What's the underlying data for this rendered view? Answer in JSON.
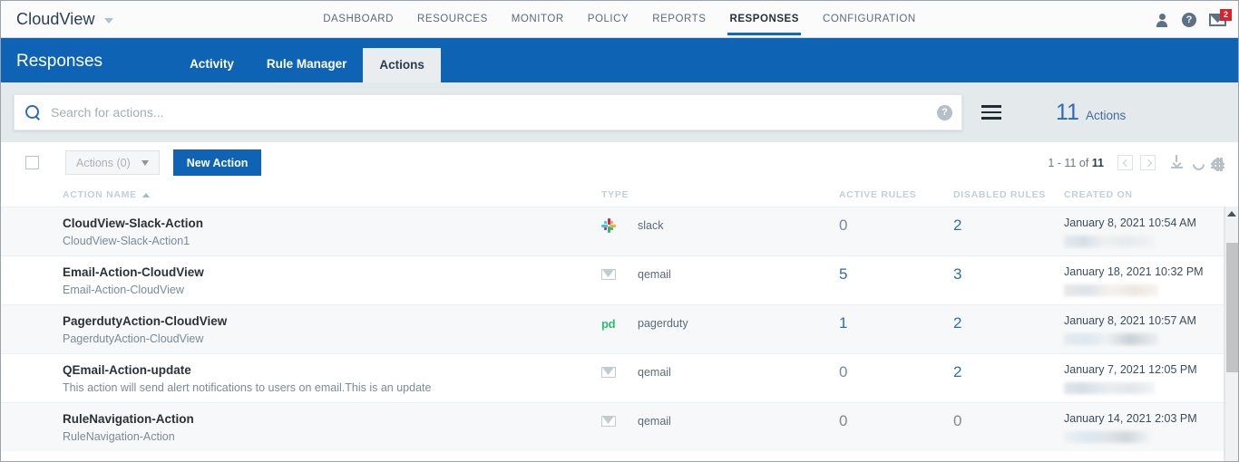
{
  "topbar": {
    "brand": "CloudView",
    "nav": [
      {
        "label": "DASHBOARD",
        "active": false
      },
      {
        "label": "RESOURCES",
        "active": false
      },
      {
        "label": "MONITOR",
        "active": false
      },
      {
        "label": "POLICY",
        "active": false
      },
      {
        "label": "REPORTS",
        "active": false
      },
      {
        "label": "RESPONSES",
        "active": true
      },
      {
        "label": "CONFIGURATION",
        "active": false
      }
    ],
    "help_glyph": "?",
    "mail_badge": "2"
  },
  "subheader": {
    "title": "Responses",
    "tabs": [
      {
        "label": "Activity",
        "active": false
      },
      {
        "label": "Rule Manager",
        "active": false
      },
      {
        "label": "Actions",
        "active": true
      }
    ]
  },
  "search": {
    "placeholder": "Search for actions...",
    "value": "",
    "help_glyph": "?",
    "count": "11",
    "count_label": "Actions"
  },
  "toolbar": {
    "actions_dropdown": "Actions (0)",
    "new_action": "New Action",
    "pager_text_prefix": "1 - 11 of ",
    "pager_total": "11"
  },
  "table": {
    "columns": [
      {
        "key": "name",
        "label": "ACTION NAME",
        "sorted": true
      },
      {
        "key": "type",
        "label": "TYPE"
      },
      {
        "key": "active",
        "label": "ACTIVE RULES"
      },
      {
        "key": "disabled",
        "label": "DISABLED RULES"
      },
      {
        "key": "created",
        "label": "CREATED ON"
      }
    ],
    "rows": [
      {
        "name": "CloudView-Slack-Action",
        "desc": "CloudView-Slack-Action1",
        "type_icon": "slack-icon",
        "type": "slack",
        "active_rules": "0",
        "active_is_link": false,
        "disabled_rules": "2",
        "disabled_is_link": true,
        "created": "January 8, 2021 10:54 AM"
      },
      {
        "name": "Email-Action-CloudView",
        "desc": "Email-Action-CloudView",
        "type_icon": "envelope-icon",
        "type": "qemail",
        "active_rules": "5",
        "active_is_link": true,
        "disabled_rules": "3",
        "disabled_is_link": true,
        "created": "January 18, 2021 10:32 PM"
      },
      {
        "name": "PagerdutyAction-CloudView",
        "desc": "PagerdutyAction-CloudView",
        "type_icon": "pagerduty-icon",
        "type": "pagerduty",
        "active_rules": "1",
        "active_is_link": true,
        "disabled_rules": "2",
        "disabled_is_link": true,
        "created": "January 8, 2021 10:57 AM"
      },
      {
        "name": "QEmail-Action-update",
        "desc": "This action will send alert notifications to users on email.This is an update",
        "type_icon": "envelope-icon",
        "type": "qemail",
        "active_rules": "0",
        "active_is_link": false,
        "disabled_rules": "2",
        "disabled_is_link": true,
        "created": "January 7, 2021 12:05 PM"
      },
      {
        "name": "RuleNavigation-Action",
        "desc": "RuleNavigation-Action",
        "type_icon": "envelope-icon",
        "type": "qemail",
        "active_rules": "0",
        "active_is_link": false,
        "disabled_rules": "0",
        "disabled_is_link": false,
        "created": "January 14, 2021 2:03 PM"
      }
    ]
  },
  "colors": {
    "brand_blue": "#0f63b5",
    "link_blue": "#2f6bb3",
    "badge_red": "#d8232a",
    "pagerduty_green": "#2bbd70"
  }
}
